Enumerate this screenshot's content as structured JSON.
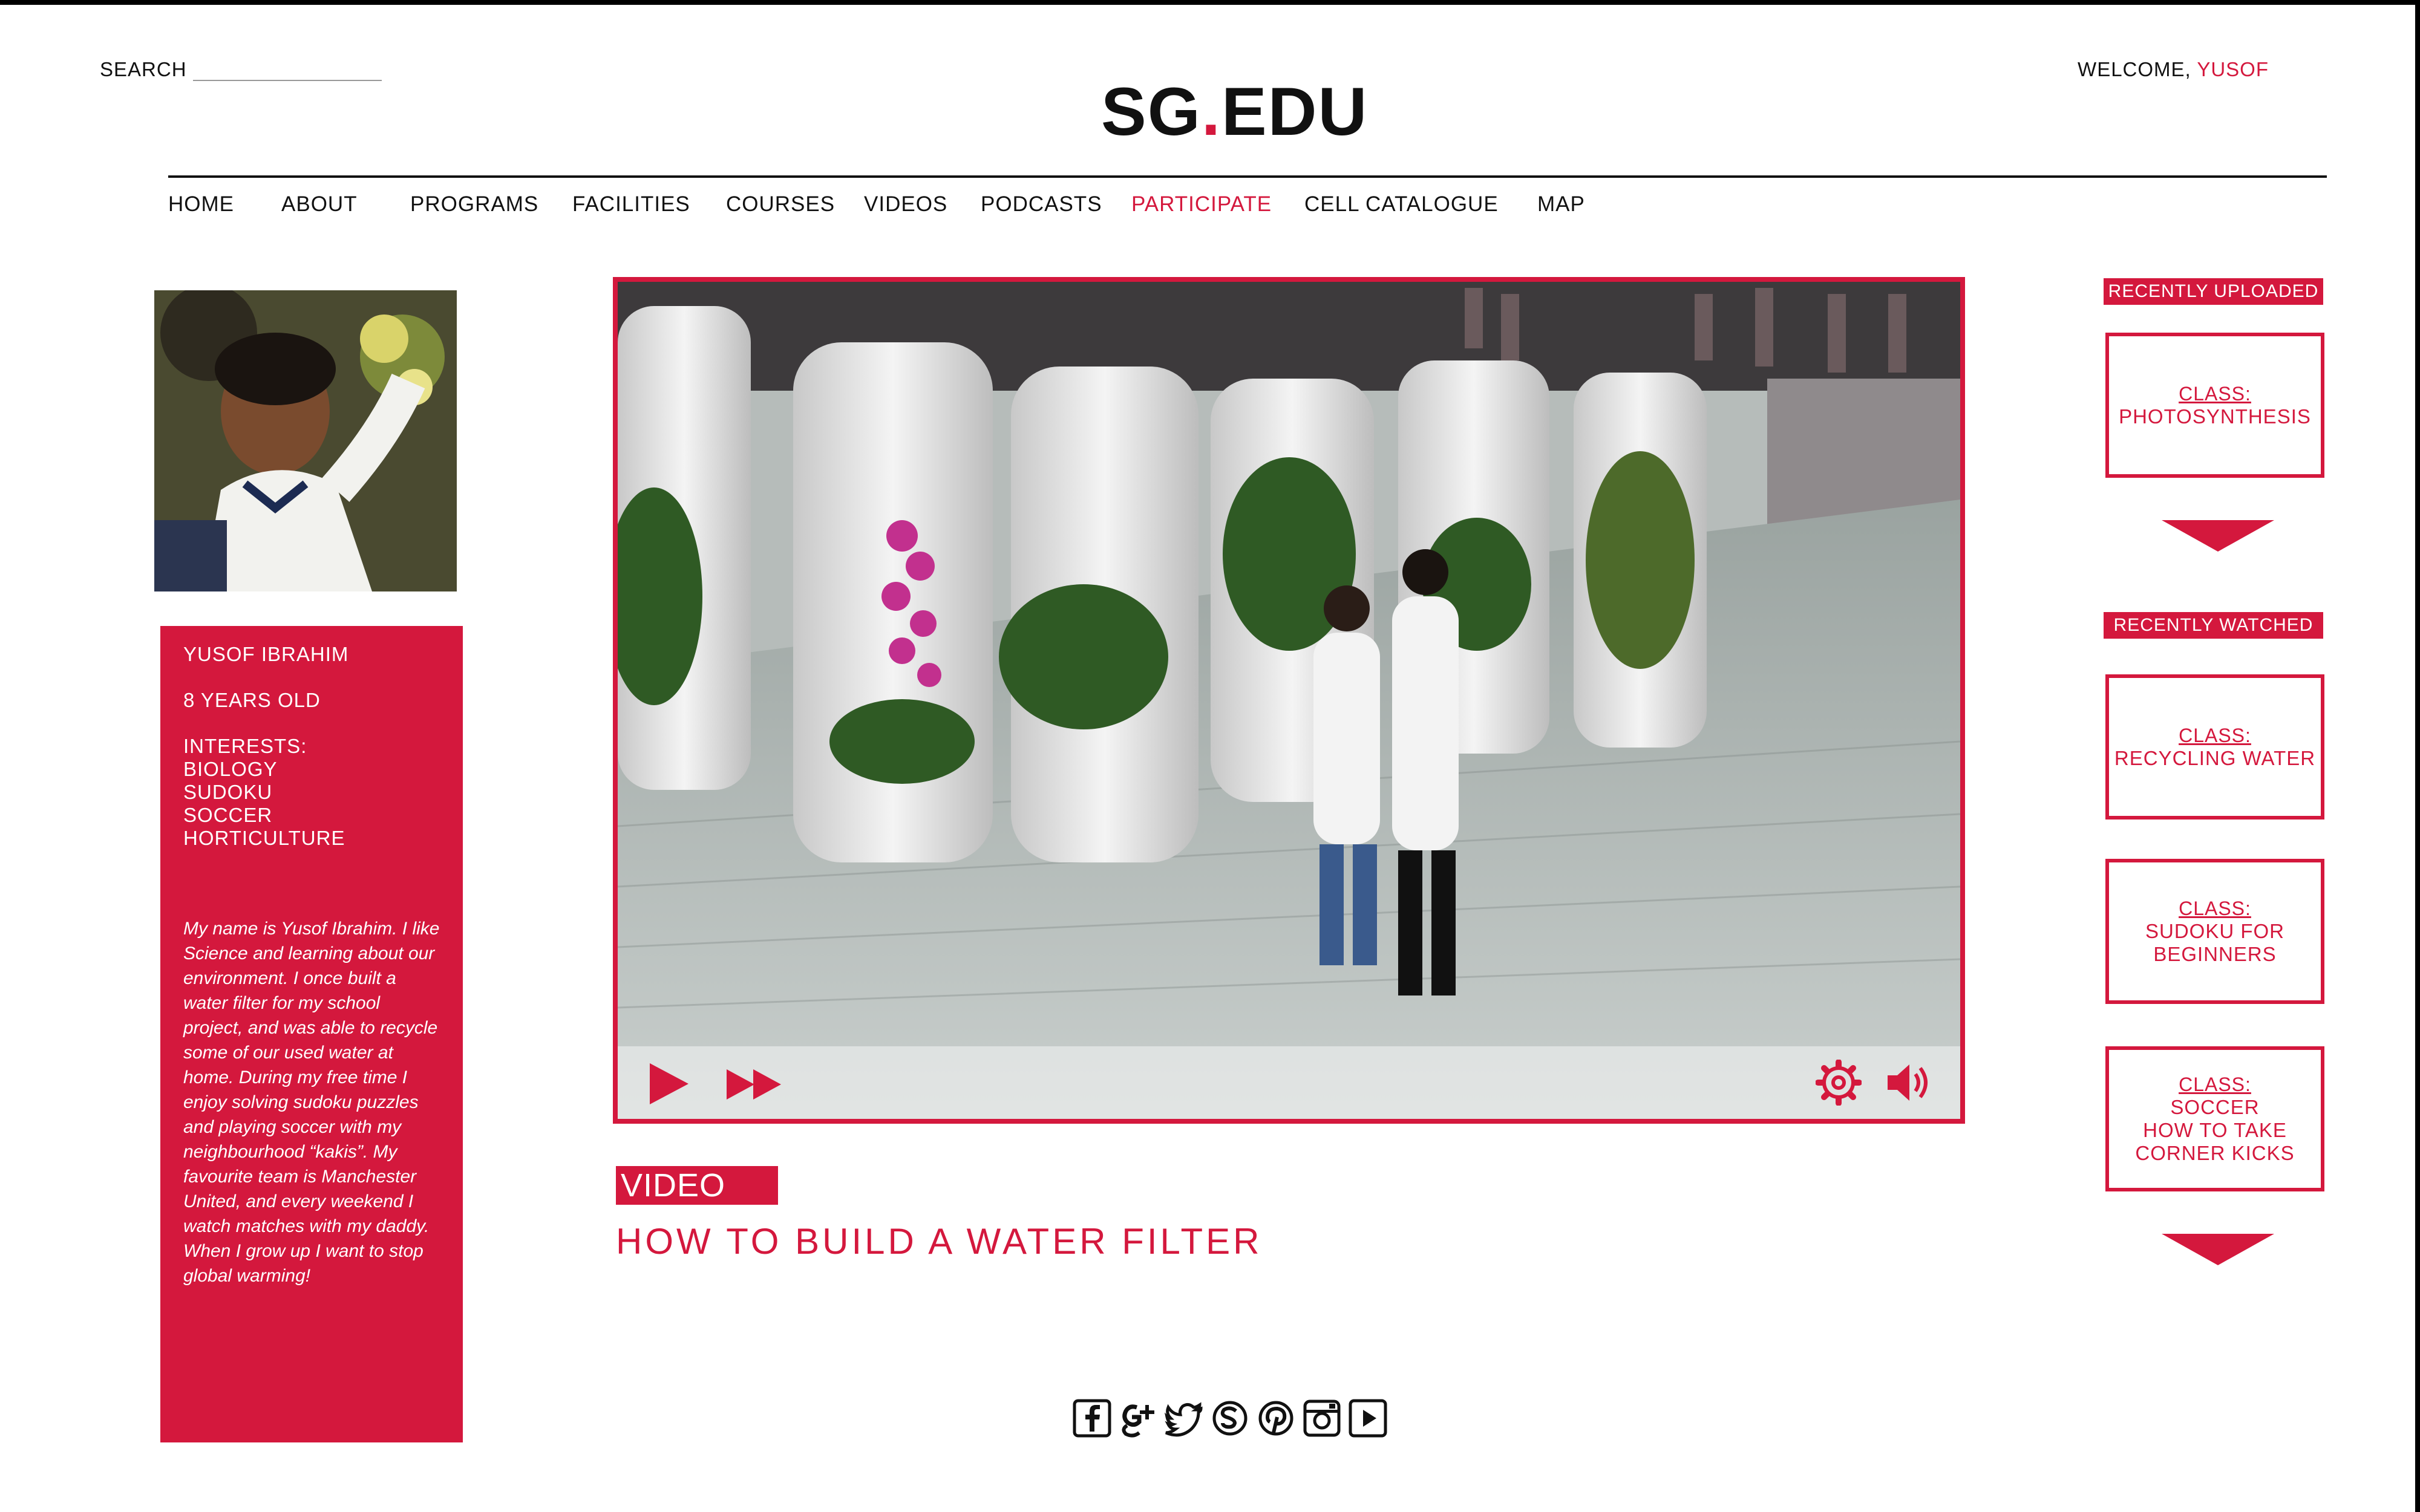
{
  "header": {
    "search_label": "SEARCH",
    "search_value": "",
    "logo_main": "SG",
    "logo_dot": ".",
    "logo_suffix": "EDU",
    "welcome_prefix": "WELCOME, ",
    "welcome_user": "YUSOF"
  },
  "nav": {
    "items": [
      {
        "label": "HOME"
      },
      {
        "label": "ABOUT"
      },
      {
        "label": "PROGRAMS"
      },
      {
        "label": "FACILITIES"
      },
      {
        "label": "COURSES"
      },
      {
        "label": "VIDEOS"
      },
      {
        "label": "PODCASTS"
      },
      {
        "label": "PARTICIPATE"
      },
      {
        "label": "CELL CATALOGUE"
      },
      {
        "label": "MAP"
      }
    ],
    "active": "PARTICIPATE"
  },
  "profile": {
    "name": "YUSOF IBRAHIM",
    "age": "8 YEARS OLD",
    "interests_label": "INTERESTS:",
    "interests": [
      "BIOLOGY",
      "SUDOKU",
      "SOCCER",
      "HORTICULTURE"
    ],
    "bio": "My name is Yusof Ibrahim. I like Science and learning about our environment. I once built a water filter for my school project, and was able to recycle some of our used water at home. During my free time I enjoy solving sudoku puzzles and playing soccer with my neighbourhood “kakis”. My favourite team is Manchester United, and every weekend I watch matches with my daddy. When I grow up I want to stop global warming!"
  },
  "video": {
    "tag": "VIDEO",
    "title": "HOW TO BUILD A WATER FILTER",
    "controls": [
      "play-icon",
      "fast-forward-icon",
      "gear-icon",
      "volume-icon"
    ]
  },
  "sidebar": {
    "recently_uploaded_label": "RECENTLY UPLOADED",
    "recently_watched_label": "RECENTLY WATCHED",
    "uploaded": [
      {
        "class_label": "CLASS:",
        "title_lines": [
          "PHOTOSYNTHESIS"
        ]
      }
    ],
    "watched": [
      {
        "class_label": "CLASS:",
        "title_lines": [
          "RECYCLING WATER"
        ]
      },
      {
        "class_label": "CLASS:",
        "title_lines": [
          "SUDOKU FOR",
          "BEGINNERS"
        ]
      },
      {
        "class_label": "CLASS:",
        "title_lines": [
          "SOCCER",
          "HOW TO TAKE",
          "CORNER KICKS"
        ]
      }
    ]
  },
  "social": [
    "facebook-icon",
    "google-plus-icon",
    "twitter-icon",
    "skype-icon",
    "pinterest-icon",
    "instagram-icon",
    "youtube-icon"
  ],
  "colors": {
    "accent": "#d4183d",
    "text": "#111111",
    "background": "#ffffff"
  }
}
